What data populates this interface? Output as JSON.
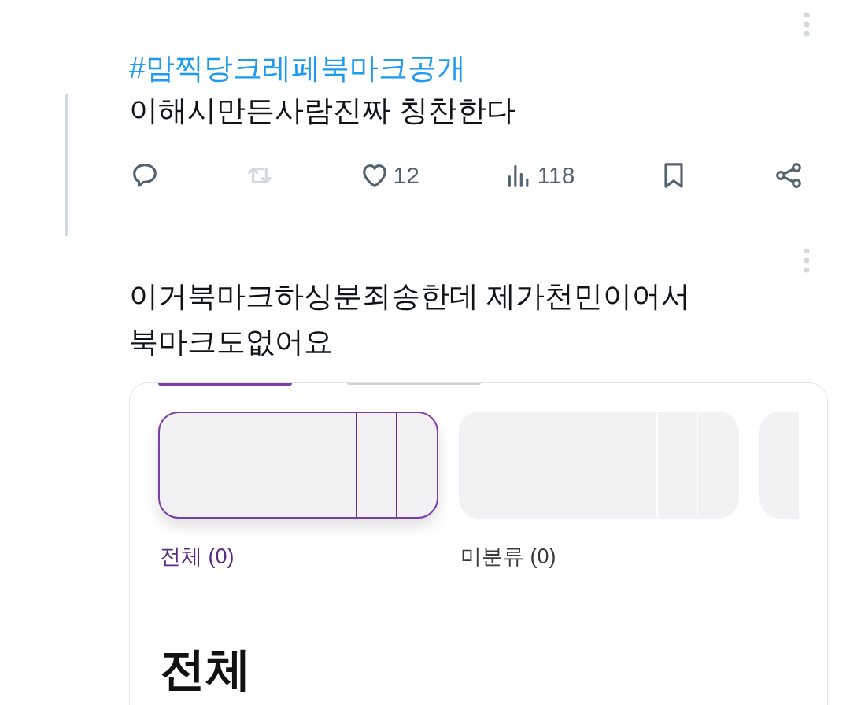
{
  "posts": [
    {
      "hashtag": "#맘찍당크레페북마크공개",
      "text": "이해시만든사람진짜 칭찬한다",
      "thread_line": true,
      "actions": [
        {
          "kind": "reply",
          "disabled": false
        },
        {
          "kind": "repost",
          "disabled": true
        },
        {
          "kind": "like",
          "count": "12",
          "disabled": false
        },
        {
          "kind": "views",
          "count": "118",
          "disabled": false
        },
        {
          "kind": "bookmark",
          "disabled": false
        },
        {
          "kind": "share",
          "disabled": false
        }
      ]
    },
    {
      "text": "이거북마크하싱분죄송한데 제가천민이어서\n북마크도없어요",
      "thread_line": false,
      "embed": {
        "folders": [
          {
            "label": "전체 (0)",
            "selected": true
          },
          {
            "label": "미분류 (0)",
            "selected": false
          },
          {
            "selected": false
          }
        ],
        "heading": "전체"
      }
    }
  ]
}
